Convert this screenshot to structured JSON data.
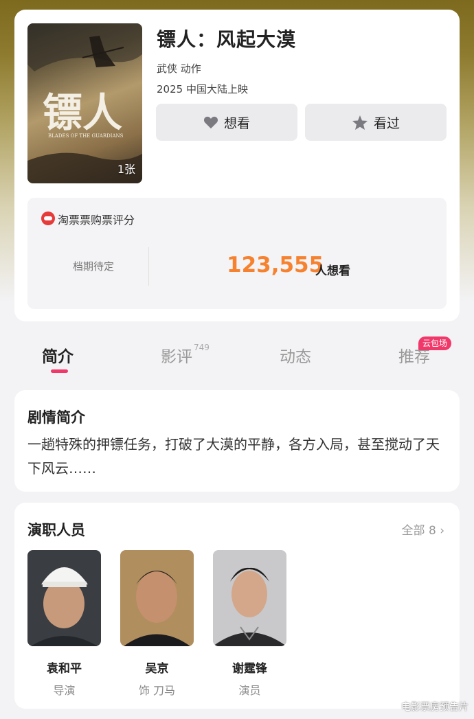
{
  "movie": {
    "title": "镖人：风起大漠",
    "genre": "武侠 动作",
    "release": "2025 中国大陆上映",
    "poster_count": "1张",
    "poster_art_text": "镖人",
    "poster_subtitle": "BLADES OF THE GUARDIANS"
  },
  "actions": {
    "want_label": "想看",
    "want_icon": "heart-icon",
    "seen_label": "看过",
    "seen_icon": "star-icon"
  },
  "score": {
    "source_label": "淘票票购票评分",
    "schedule": "档期待定",
    "want_count": "123,555",
    "want_suffix": "人想看"
  },
  "tabs": [
    {
      "label": "简介",
      "active": true
    },
    {
      "label": "影评",
      "count": "749"
    },
    {
      "label": "动态"
    },
    {
      "label": "推荐",
      "badge": "云包场"
    }
  ],
  "synopsis": {
    "title": "剧情简介",
    "text": "一趟特殊的押镖任务，打破了大漠的平静，各方入局，甚至搅动了天下风云……"
  },
  "cast": {
    "title": "演职人员",
    "all_label": "全部 8",
    "people": [
      {
        "name": "袁和平",
        "role": "导演"
      },
      {
        "name": "吴京",
        "role": "饰 刀马"
      },
      {
        "name": "谢霆锋",
        "role": "演员"
      }
    ]
  },
  "watermark": "电影票房预告片",
  "colors": {
    "accent": "#f0396a",
    "want_count": "#f6822f",
    "button_bg": "#ebebee"
  }
}
